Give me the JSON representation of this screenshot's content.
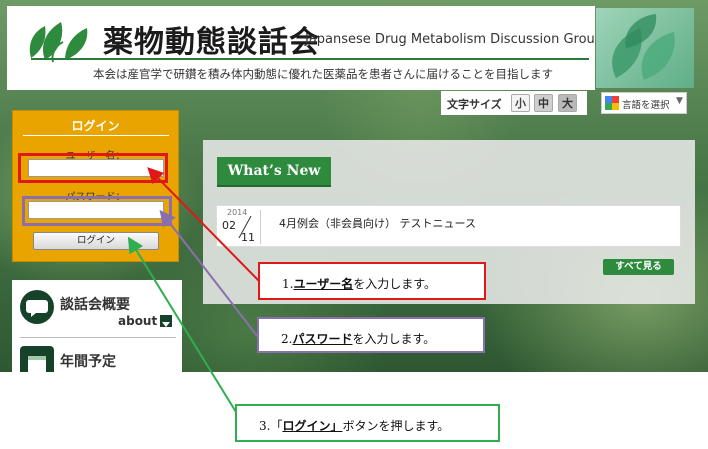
{
  "header": {
    "title_jp": "薬物動態談話会",
    "title_en": "Japansese Drug Metabolism Discussion Group",
    "tagline": "本会は産官学で研鑽を積み体内動態に優れた医薬品を患者さんに届けることを目指します"
  },
  "font_size": {
    "label": "文字サイズ",
    "small": "小",
    "medium": "中",
    "large": "大"
  },
  "language": {
    "label": "言語を選択",
    "caret": "▼"
  },
  "login": {
    "title": "ログイン",
    "username_label": "ユーザー名：",
    "password_label": "パスワード：",
    "button_label": "ログイン"
  },
  "nav": {
    "overview_label": "談話会概要",
    "overview_sub": "about",
    "schedule_label": "年間予定"
  },
  "news": {
    "tab_label": "What’s New",
    "items": [
      {
        "year": "2014",
        "month": "02",
        "day": "11",
        "title": "4月例会（非会員向け） テストニュース"
      }
    ],
    "see_all_label": "すべて見る"
  },
  "callouts": [
    {
      "prefix": "1.",
      "emph": "ユーザー名",
      "suffix": "を入力します。",
      "color": "#e01818"
    },
    {
      "prefix": "2.",
      "emph": "パスワード",
      "suffix": "を入力します。",
      "color": "#8a6fae"
    },
    {
      "prefix": "3.「",
      "emph": "ログイン」",
      "suffix": "ボタンを押します。",
      "color": "#2fae4f"
    }
  ],
  "colors": {
    "brand_green": "#2e8b3e",
    "login_orange": "#e9a400",
    "dark_green": "#17422a"
  }
}
